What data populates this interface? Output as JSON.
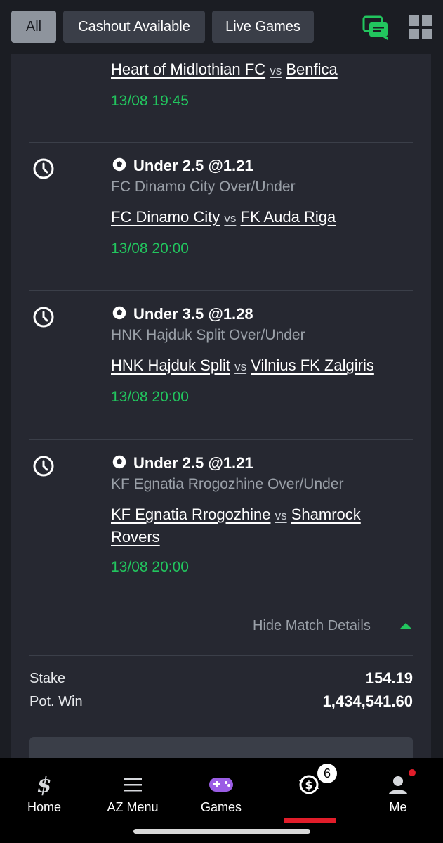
{
  "filters": {
    "all": "All",
    "cashout": "Cashout Available",
    "live": "Live Games"
  },
  "top_icons": [
    "chat-icon",
    "grid-icon"
  ],
  "first_leg": {
    "home": "Heart of Midlothian FC",
    "vs": "vs",
    "away": "Benfica",
    "time": "13/08 19:45"
  },
  "legs": [
    {
      "selection": "Under 2.5 @1.21",
      "market": "FC Dinamo City Over/Under",
      "home": "FC Dinamo City",
      "vs": "vs",
      "away": "FK Auda Riga",
      "time": "13/08 20:00"
    },
    {
      "selection": "Under 3.5 @1.28",
      "market": "HNK Hajduk Split Over/Under",
      "home": "HNK Hajduk Split",
      "vs": "vs",
      "away": "Vilnius FK Zalgiris",
      "time": "13/08 20:00"
    },
    {
      "selection": "Under 2.5 @1.21",
      "market": "KF Egnatia Rrogozhine Over/Under",
      "home": "KF Egnatia Rrogozhine",
      "vs": "vs",
      "away": "Shamrock Rovers",
      "time": "13/08 20:00"
    }
  ],
  "hide_details": "Hide Match Details",
  "summary": {
    "stake_label": "Stake",
    "stake_value": "154.19",
    "potwin_label": "Pot. Win",
    "potwin_value": "1,434,541.60"
  },
  "nav": {
    "home": "Home",
    "az": "AZ Menu",
    "games": "Games",
    "bets_badge": "6",
    "me": "Me"
  },
  "colors": {
    "accent_green": "#22c55e",
    "active_red": "#e11d2a",
    "card_bg": "#262831"
  }
}
